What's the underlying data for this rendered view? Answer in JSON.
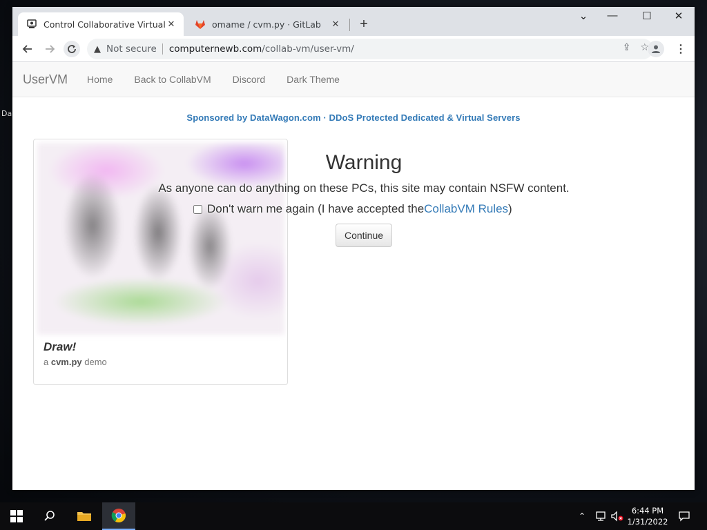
{
  "desktop": {
    "fragment": "Da"
  },
  "tabs": [
    {
      "title": "Control Collaborative Virtual Ma",
      "close": "✕"
    },
    {
      "title": "omame / cvm.py · GitLab",
      "close": "✕"
    }
  ],
  "new_tab": "+",
  "window_controls": {
    "dropdown": "⌄",
    "minimize": "—",
    "maximize": "☐",
    "close": "✕"
  },
  "address_bar": {
    "security": "Not secure",
    "host": "computernewb.com",
    "path": "/collab-vm/user-vm/"
  },
  "navbar": {
    "brand": "UserVM",
    "links": [
      "Home",
      "Back to CollabVM",
      "Discord",
      "Dark Theme"
    ]
  },
  "sponsor": "Sponsored by DataWagon.com · DDoS Protected Dedicated & Virtual Servers",
  "card": {
    "title": "Draw!",
    "subtitle_prefix": "a ",
    "subtitle_bold": "cvm.py",
    "subtitle_suffix": " demo"
  },
  "warning": {
    "title": "Warning",
    "text": "As anyone can do anything on these PCs, this site may contain NSFW content.",
    "checkbox_label": "Don't warn me again (I have accepted the ",
    "rules_link": "CollabVM Rules",
    "close_paren": ")",
    "continue": "Continue"
  },
  "taskbar": {
    "time": "6:44 PM",
    "date": "1/31/2022"
  },
  "colors": {
    "link": "#337ab7",
    "taskbar": "#0c0c0e",
    "tabstrip": "#dee1e6"
  }
}
